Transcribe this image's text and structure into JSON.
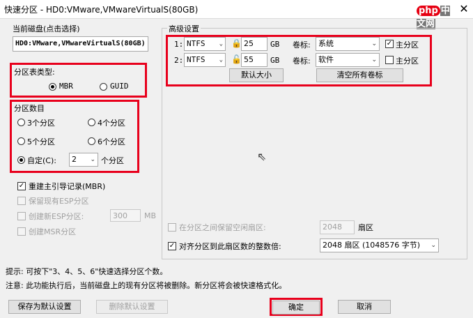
{
  "window": {
    "title": "快速分区 - HD0:VMware,VMwareVirtualS(80GB)",
    "close": "✕",
    "watermark_a": "php",
    "watermark_b": "中文网"
  },
  "left": {
    "disk_group_label": "当前磁盘(点击选择)",
    "disk_value": "HD0:VMware,VMwareVirtualS(80GB)",
    "table_type_label": "分区表类型:",
    "mbr": "MBR",
    "guid": "GUID",
    "count_label": "分区数目",
    "r3": "3个分区",
    "r4": "4个分区",
    "r5": "5个分区",
    "r6": "6个分区",
    "custom": "自定(C):",
    "custom_value": "2",
    "custom_unit": "个分区",
    "rebuild_mbr": "重建主引导记录(MBR)",
    "keep_esp": "保留现有ESP分区",
    "create_esp": "创建新ESP分区:",
    "esp_size": "300",
    "esp_unit": "MB",
    "create_msr": "创建MSR分区"
  },
  "right": {
    "group_label": "高级设置",
    "rows": [
      {
        "index": "1:",
        "fs": "NTFS",
        "size": "25",
        "unit": "GB",
        "vol_label": "卷标:",
        "vol": "系统",
        "primary": "主分区",
        "primary_checked": true
      },
      {
        "index": "2:",
        "fs": "NTFS",
        "size": "55",
        "unit": "GB",
        "vol_label": "卷标:",
        "vol": "软件",
        "primary": "主分区",
        "primary_checked": false
      }
    ],
    "default_size_btn": "默认大小",
    "clear_labels_btn": "清空所有卷标",
    "reserve_label": "在分区之间保留空闲扇区:",
    "reserve_value": "2048",
    "reserve_unit": "扇区",
    "align_label": "对齐分区到此扇区数的整数倍:",
    "align_value": "2048 扇区 (1048576 字节)"
  },
  "footer": {
    "tip": "提示: 可按下\"3、4、5、6\"快速选择分区个数。",
    "note": "注意: 此功能执行后，当前磁盘上的现有分区将被删除。新分区将会被快速格式化。",
    "save_default": "保存为默认设置",
    "delete_default": "删除默认设置",
    "ok": "确定",
    "cancel": "取消"
  },
  "colors": {
    "highlight": "#e8001c",
    "background": "#f0f0f0"
  }
}
